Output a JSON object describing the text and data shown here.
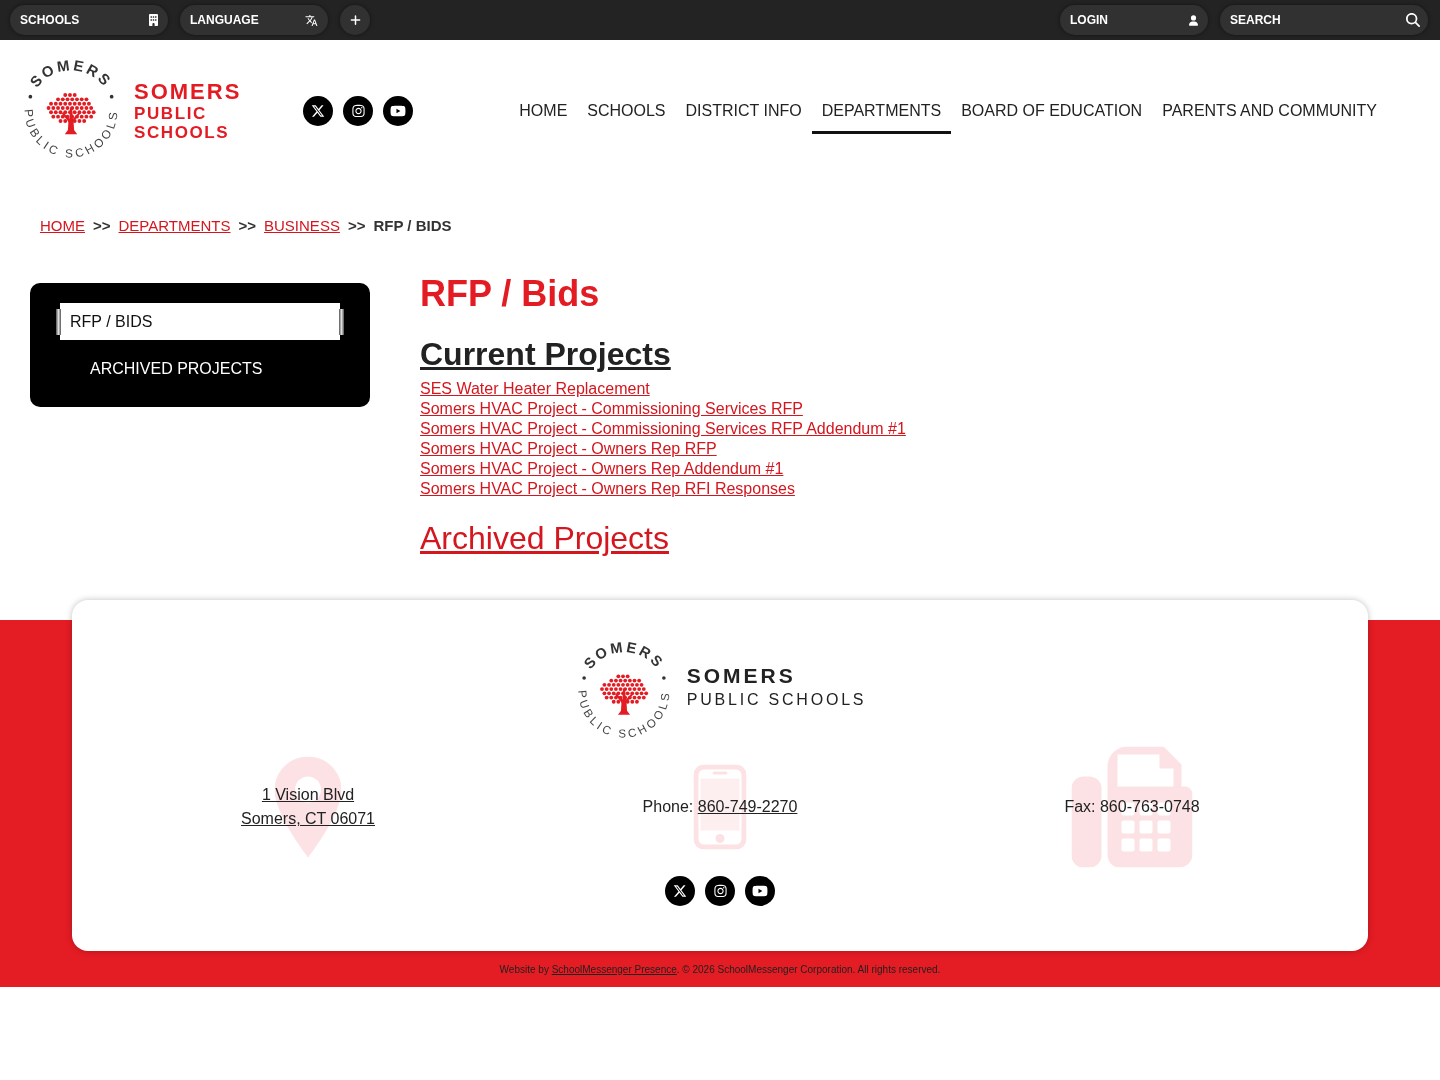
{
  "utility_bar": {
    "schools_button": {
      "label": "SCHOOLS"
    },
    "language_button": {
      "label": "LANGUAGE"
    },
    "login_button": {
      "label": "LOGIN"
    },
    "search": {
      "placeholder": "SEARCH"
    }
  },
  "header": {
    "seal": {
      "ring_top": "SOMERS",
      "ring_bottom": "PUBLIC SCHOOLS"
    },
    "name_lines": [
      "SOMERS",
      "PUBLIC",
      "SCHOOLS"
    ],
    "nav": [
      {
        "label": "HOME",
        "selected": false
      },
      {
        "label": "SCHOOLS",
        "selected": false
      },
      {
        "label": "DISTRICT INFO",
        "selected": false
      },
      {
        "label": "DEPARTMENTS",
        "selected": true
      },
      {
        "label": "BOARD OF EDUCATION",
        "selected": false
      },
      {
        "label": "PARENTS AND COMMUNITY",
        "selected": false
      }
    ]
  },
  "breadcrumb": [
    {
      "kind": "link",
      "text": "HOME"
    },
    {
      "kind": "separator",
      "text": ">>"
    },
    {
      "kind": "link",
      "text": "DEPARTMENTS"
    },
    {
      "kind": "separator",
      "text": ">>"
    },
    {
      "kind": "link",
      "text": "BUSINESS"
    },
    {
      "kind": "separator",
      "text": ">>"
    },
    {
      "kind": "current",
      "text": "RFP / BIDS"
    }
  ],
  "sidebar": {
    "items": [
      {
        "label": "RFP / BIDS",
        "selected": true
      },
      {
        "label": "ARCHIVED PROJECTS",
        "selected": false
      }
    ]
  },
  "content": {
    "title": "RFP / Bids",
    "current_heading": "Current Projects",
    "project_links": [
      "SES Water Heater Replacement",
      "Somers HVAC Project - Commissioning Services RFP",
      "Somers HVAC Project - Commissioning Services RFP Addendum #1",
      "Somers HVAC Project - Owners Rep RFP",
      "Somers HVAC Project - Owners Rep Addendum #1",
      "Somers HVAC Project - Owners Rep RFI Responses"
    ],
    "archived_link": "Archived Projects"
  },
  "footer": {
    "seal": {
      "ring_top": "SOMERS",
      "ring_bottom": "PUBLIC SCHOOLS"
    },
    "name": "SOMERS",
    "subtitle": "PUBLIC SCHOOLS",
    "address_lines": [
      "1 Vision Blvd",
      "Somers, CT 06071"
    ],
    "phone": {
      "label": "Phone:",
      "number": "860-749-2270"
    },
    "fax": "Fax: 860-763-0748",
    "credit": {
      "prefix": "Website by",
      "link": "SchoolMessenger Presence",
      "suffix": ". © 2026 SchoolMessenger Corporation. All rights reserved."
    }
  }
}
